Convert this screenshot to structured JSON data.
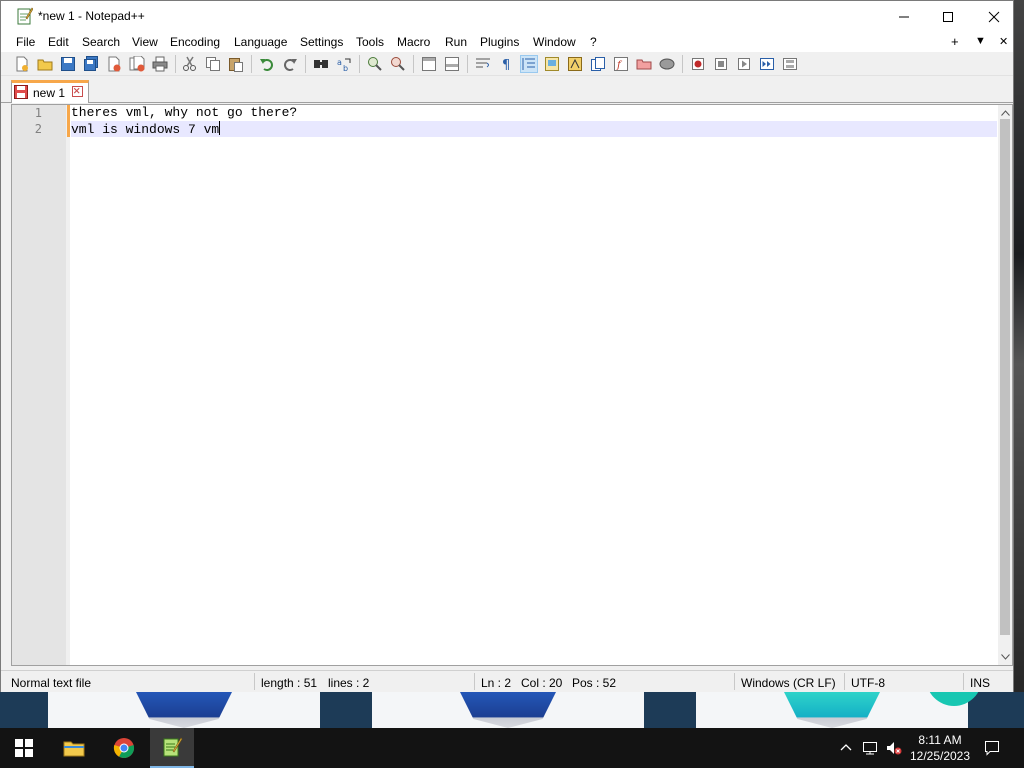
{
  "window": {
    "title": "*new 1 - Notepad++"
  },
  "menu": {
    "items": [
      "File",
      "Edit",
      "Search",
      "View",
      "Encoding",
      "Language",
      "Settings",
      "Tools",
      "Macro",
      "Run",
      "Plugins",
      "Window",
      "?"
    ],
    "right": [
      "+",
      "▼",
      "✕"
    ]
  },
  "toolbar": {
    "icons": [
      "new-file-icon",
      "open-file-icon",
      "save-icon",
      "save-all-icon",
      "close-icon",
      "close-all-icon",
      "print-icon",
      "cut-icon",
      "copy-icon",
      "paste-icon",
      "undo-icon",
      "redo-icon",
      "find-icon",
      "replace-icon",
      "zoom-in-icon",
      "zoom-out-icon",
      "sync-vertical-icon",
      "sync-horizontal-icon",
      "word-wrap-icon",
      "show-all-chars-icon",
      "indent-guide-icon",
      "udl-icon",
      "doc-map-icon",
      "doc-list-icon",
      "function-list-icon",
      "folder-as-workspace-icon",
      "monitoring-icon",
      "record-macro-icon",
      "stop-macro-icon",
      "play-macro-icon",
      "run-macro-multiple-icon",
      "save-macro-icon"
    ]
  },
  "tab": {
    "label": "new 1"
  },
  "editor": {
    "lines": [
      {
        "number": "1",
        "text": "theres vml, why not go there?"
      },
      {
        "number": "2",
        "text": "vml is windows 7 vm"
      }
    ]
  },
  "status": {
    "file_type": "Normal text file",
    "length": "length : 51",
    "lines": "lines : 2",
    "ln": "Ln : 2",
    "col": "Col : 20",
    "pos": "Pos : 52",
    "eol": "Windows (CR LF)",
    "encoding": "UTF-8",
    "mode": "INS"
  },
  "taskbar": {
    "apps": [
      "start-icon",
      "file-explorer-icon",
      "chrome-icon",
      "notepadpp-icon"
    ],
    "time": "8:11 AM",
    "date": "12/25/2023"
  },
  "colors": {
    "tab_accent": "#f7a74a",
    "current_line": "#e8e8ff",
    "taskbar": "#131313"
  }
}
